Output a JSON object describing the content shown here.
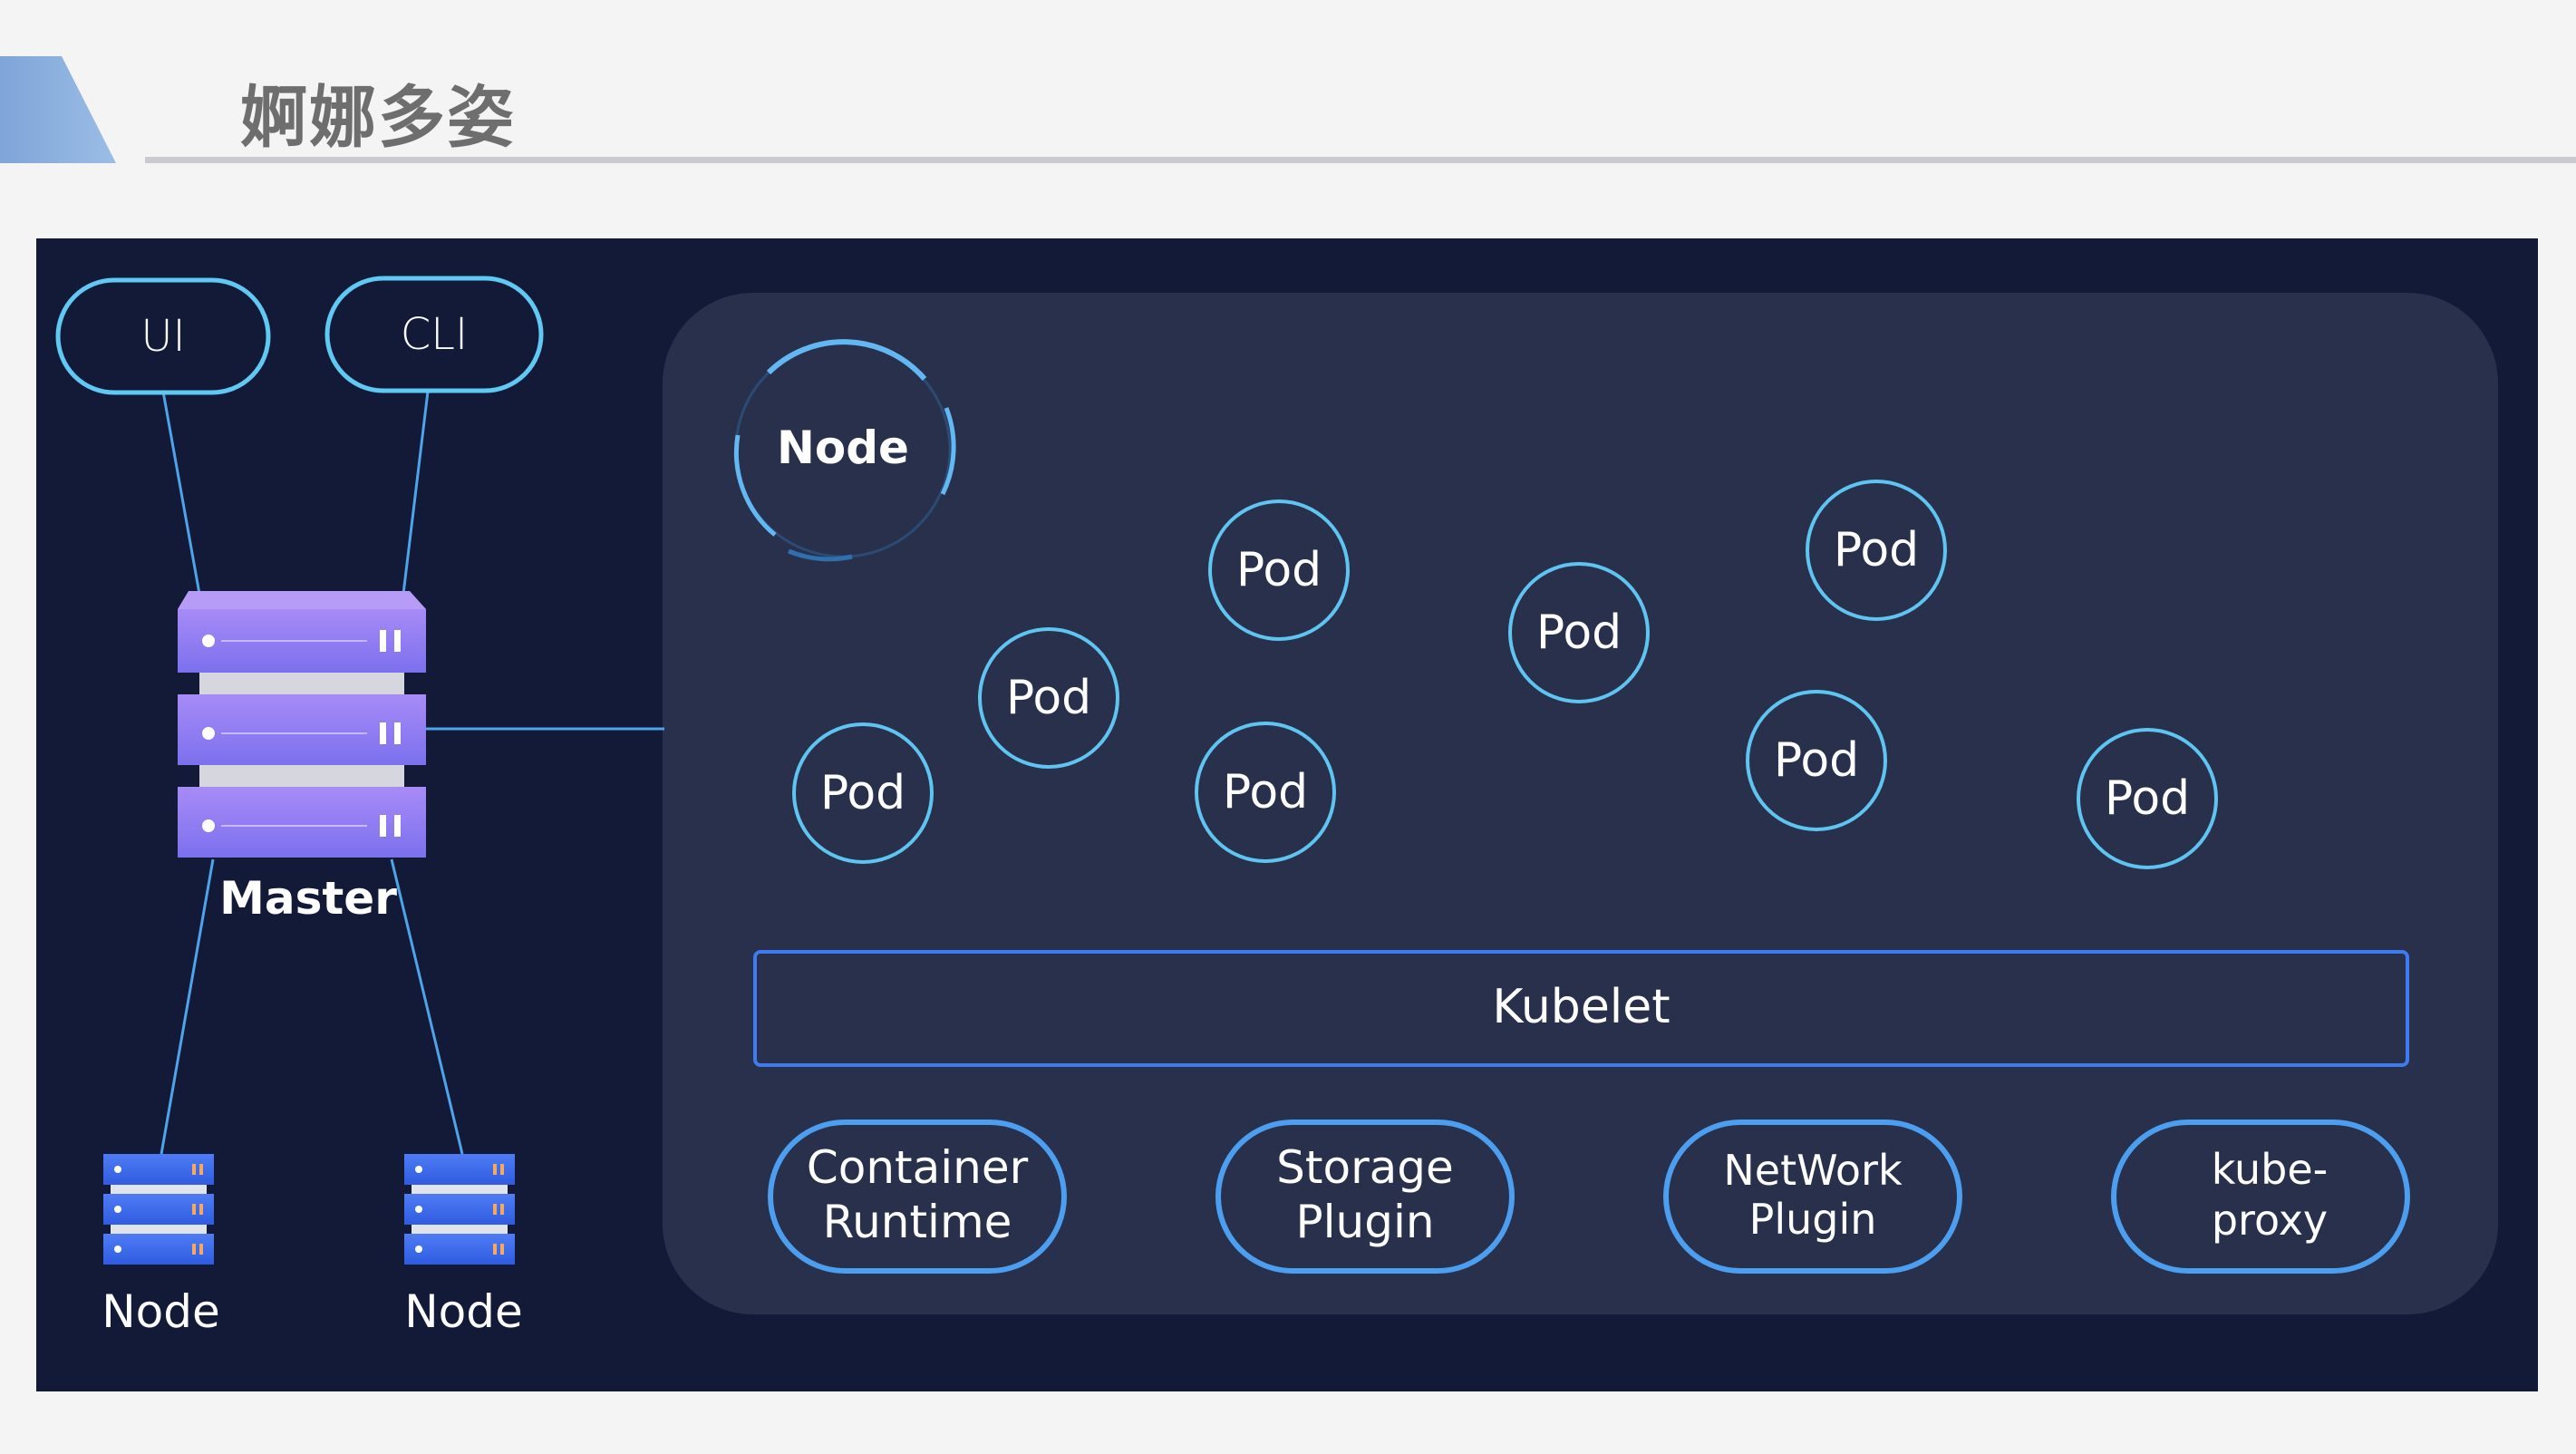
{
  "page": {
    "title": "婀娜多姿"
  },
  "colors": {
    "page_bg": "#f4f4f5",
    "panel_bg": "#121a38",
    "node_area_bg": "#28304b",
    "accent_blue": "#3d7bf0",
    "cyan": "#6ad3f7",
    "master_purple": "#8f7bf2",
    "server_blue": "#3a67e8"
  },
  "clients": {
    "ui": "UI",
    "cli": "CLI"
  },
  "master": {
    "label": "Master"
  },
  "worker_nodes": [
    {
      "label": "Node"
    },
    {
      "label": "Node"
    }
  ],
  "node_area": {
    "title": "Node",
    "pods": [
      "Pod",
      "Pod",
      "Pod",
      "Pod",
      "Pod",
      "Pod",
      "Pod",
      "Pod"
    ],
    "kubelet": "Kubelet",
    "components": [
      {
        "line1": "Container",
        "line2": "Runtime"
      },
      {
        "line1": "Storage",
        "line2": "Plugin"
      },
      {
        "line1": "NetWork",
        "line2": "Plugin"
      },
      {
        "line1": "kube-",
        "line2": "proxy"
      }
    ]
  }
}
